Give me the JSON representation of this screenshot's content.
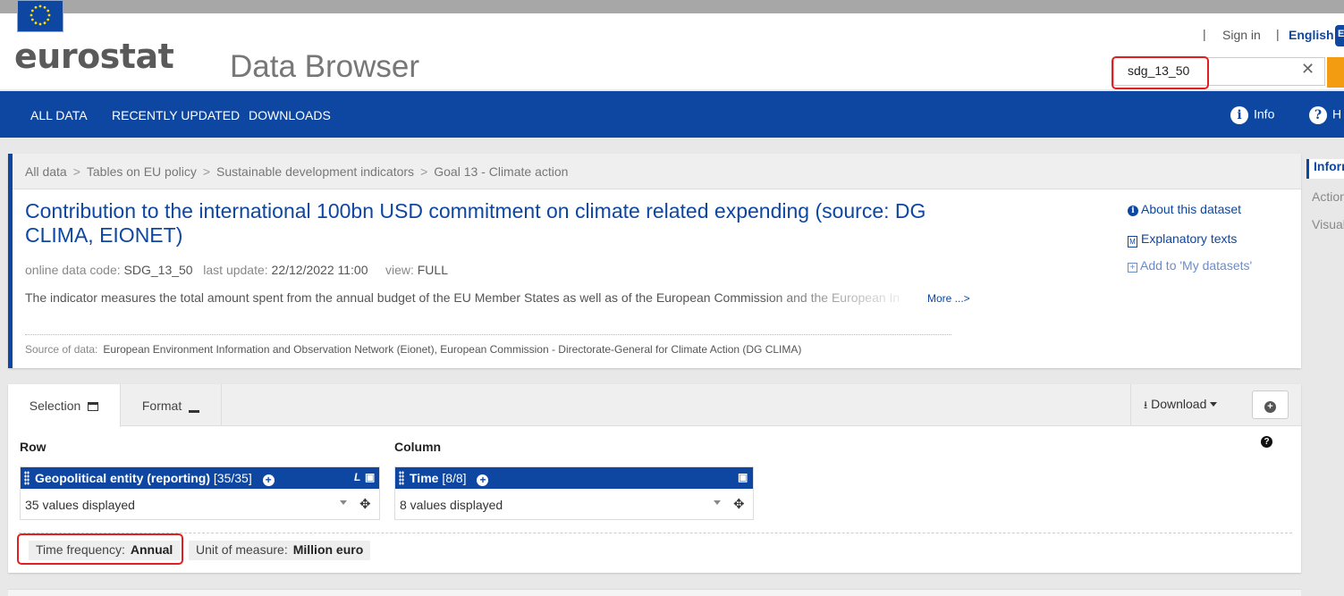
{
  "header": {
    "logo_text": "eurostat",
    "app_title": "Data Browser",
    "sep": "|",
    "sign_in": "Sign in",
    "language": "English",
    "lang_badge": "E",
    "search_value": "sdg_13_50",
    "clear_glyph": "✕"
  },
  "nav": {
    "items": [
      "ALL DATA",
      "RECENTLY UPDATED",
      "DOWNLOADS"
    ],
    "info": "Info",
    "help": "H",
    "info_glyph": "i",
    "help_glyph": "?"
  },
  "breadcrumb": [
    "All data",
    "Tables on EU policy",
    "Sustainable development indicators",
    "Goal 13 - Climate action"
  ],
  "breadcrumb_sep": ">",
  "dataset": {
    "title": "Contribution to the international 100bn USD commitment on climate related expending (source: DG CLIMA, EIONET)",
    "code_label": "online data code:",
    "code": "SDG_13_50",
    "update_label": "last update:",
    "update": "22/12/2022 11:00",
    "view_label": "view:",
    "view": "FULL",
    "description": "The indicator measures the total amount spent from the annual budget of the EU Member States as well as of the European Commission and the European In",
    "more": "More ...>",
    "source_label": "Source of data:",
    "source": "European Environment Information and Observation Network (Eionet), European Commission - Directorate-General for Climate Action (DG CLIMA)"
  },
  "side_links": {
    "about": "About this dataset",
    "explanatory": "Explanatory texts",
    "add": "Add to 'My datasets'"
  },
  "right_strip": [
    "Inform",
    "Action",
    "Visual"
  ],
  "selection": {
    "tabs": [
      "Selection",
      "Format"
    ],
    "download": "Download",
    "row_label": "Row",
    "column_label": "Column",
    "row_dim": {
      "name": "Geopolitical entity (reporting)",
      "count": "[35/35]",
      "value": "35 values displayed"
    },
    "col_dim": {
      "name": "Time",
      "count": "[8/8]",
      "value": "8 values displayed"
    },
    "filters": [
      {
        "label": "Time frequency:",
        "value": "Annual"
      },
      {
        "label": "Unit of measure:",
        "value": "Million euro"
      }
    ],
    "help_glyph": "?",
    "l_glyph": "L"
  },
  "colors": {
    "brand_blue": "#0e47a1",
    "highlight_red": "#e02020",
    "search_orange": "#f39c12"
  }
}
